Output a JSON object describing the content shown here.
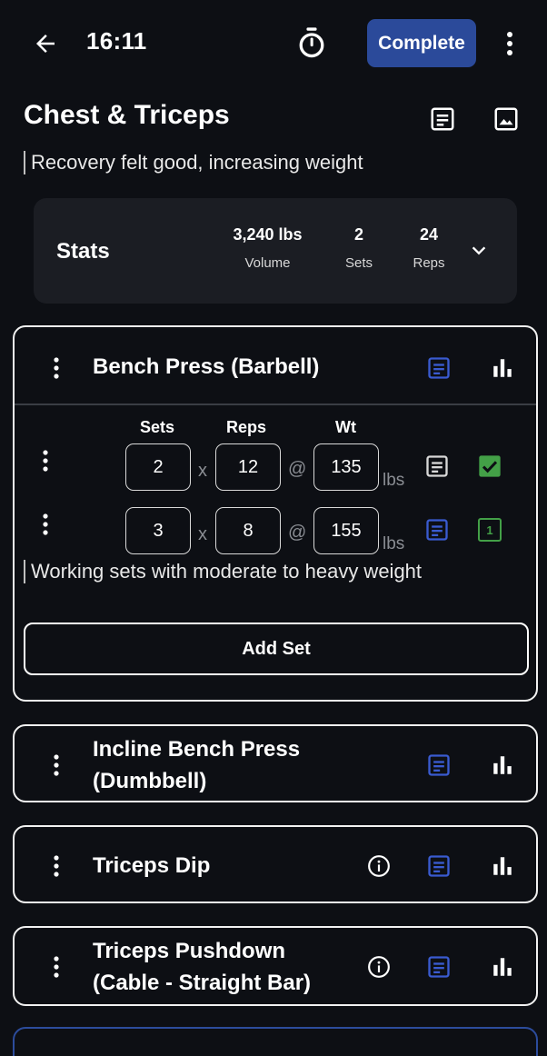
{
  "header": {
    "time": "16:11",
    "complete_label": "Complete"
  },
  "workout": {
    "title": "Chest & Triceps",
    "note": "Recovery felt good, increasing weight"
  },
  "stats": {
    "label": "Stats",
    "volume_value": "3,240 lbs",
    "volume_label": "Volume",
    "sets_value": "2",
    "sets_label": "Sets",
    "reps_value": "24",
    "reps_label": "Reps"
  },
  "exercises": [
    {
      "name": "Bench Press (Barbell)",
      "columns": {
        "sets": "Sets",
        "reps": "Reps",
        "wt": "Wt"
      },
      "sets": [
        {
          "sets": "2",
          "reps": "12",
          "weight": "135",
          "unit": "lbs",
          "status": "completed"
        },
        {
          "sets": "3",
          "reps": "8",
          "weight": "155",
          "unit": "lbs",
          "status_label": "1"
        }
      ],
      "separator_x": "x",
      "separator_at": "@",
      "note": "Working sets with moderate to heavy weight",
      "add_set_label": "Add Set"
    },
    {
      "name_line1": "Incline Bench Press",
      "name_line2": "(Dumbbell)"
    },
    {
      "name": "Triceps Dip"
    },
    {
      "name_line1": "Triceps Pushdown",
      "name_line2": "(Cable - Straight Bar)"
    }
  ],
  "colors": {
    "background": "#0d0f14",
    "accent_blue": "#2b4a9a",
    "note_icon_blue": "#3a5bd0",
    "check_green": "#43a047",
    "card_surface": "#1b1d23"
  },
  "icons": [
    "back-arrow-icon",
    "timer-icon",
    "more-vert-icon",
    "notes-icon",
    "image-icon",
    "chevron-down-icon",
    "drag-handle-icon",
    "bar-chart-icon",
    "info-icon",
    "checkbox-checked-icon",
    "set-number-icon"
  ]
}
